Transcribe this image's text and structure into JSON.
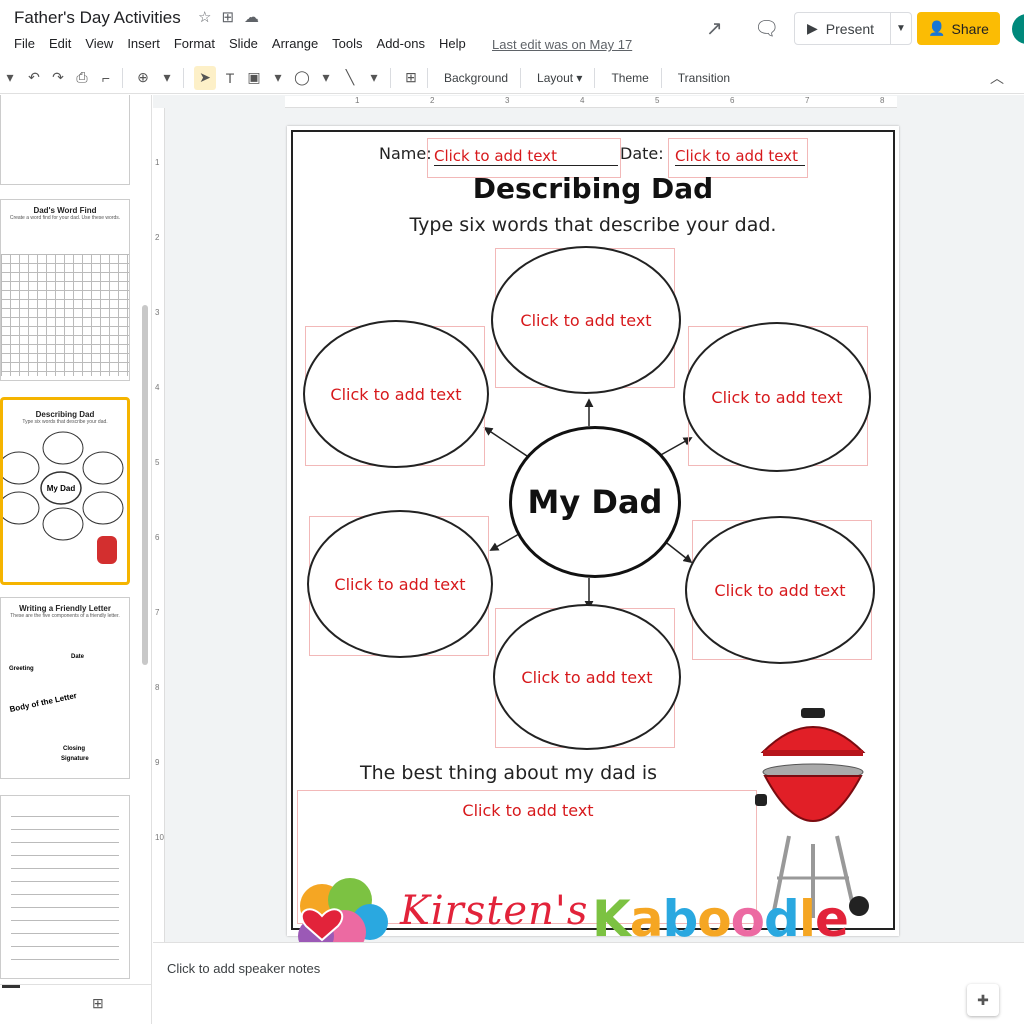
{
  "app": {
    "doc_title": "Father's Day Activities",
    "menu": [
      "File",
      "Edit",
      "View",
      "Insert",
      "Format",
      "Slide",
      "Arrange",
      "Tools",
      "Add-ons",
      "Help"
    ],
    "last_edit": "Last edit was on May 17",
    "present_label": "Present",
    "share_label": "Share"
  },
  "toolbar": {
    "background": "Background",
    "layout": "Layout",
    "theme": "Theme",
    "transition": "Transition"
  },
  "ruler": {
    "h": [
      "1",
      "2",
      "3",
      "4",
      "5",
      "6",
      "7",
      "8"
    ],
    "v": [
      "1",
      "2",
      "3",
      "4",
      "5",
      "6",
      "7",
      "8",
      "9",
      "10"
    ]
  },
  "filmstrip": {
    "slides": [
      {
        "title": "",
        "sub": ""
      },
      {
        "title": "Dad's Word Find",
        "sub": "Create a word find for your dad. Use these words."
      },
      {
        "title": "Describing Dad",
        "sub": "Type six words that describe your dad.",
        "center": "My Dad"
      },
      {
        "title": "Writing a Friendly Letter",
        "sub": "These are the five components of a friendly letter.",
        "parts": [
          "Date",
          "Greeting",
          "Body of the Letter",
          "Closing",
          "Signature"
        ]
      },
      {
        "title": "",
        "sub": ""
      }
    ]
  },
  "slide": {
    "name_label": "Name:",
    "date_label": "Date:",
    "placeholder": "Click to add text",
    "heading": "Describing Dad",
    "instruction": "Type six words that describe your dad.",
    "center": "My Dad",
    "best_label": "The best thing about my dad is"
  },
  "speaker_notes": "Click to add speaker notes",
  "watermark": {
    "part1": "Kirsten's",
    "part2_letters": [
      "K",
      "a",
      "b",
      "o",
      "o",
      "d",
      "l",
      "e"
    ],
    "part2_colors": [
      "#7cc242",
      "#f5a623",
      "#2aa8e0",
      "#f5a623",
      "#ec6aa2",
      "#2aa8e0",
      "#f5a623",
      "#e2233a"
    ]
  },
  "colors": {
    "accent_share": "#fbbc04",
    "placeholder_red": "#d7191c",
    "selected_slide": "#f5b400"
  }
}
